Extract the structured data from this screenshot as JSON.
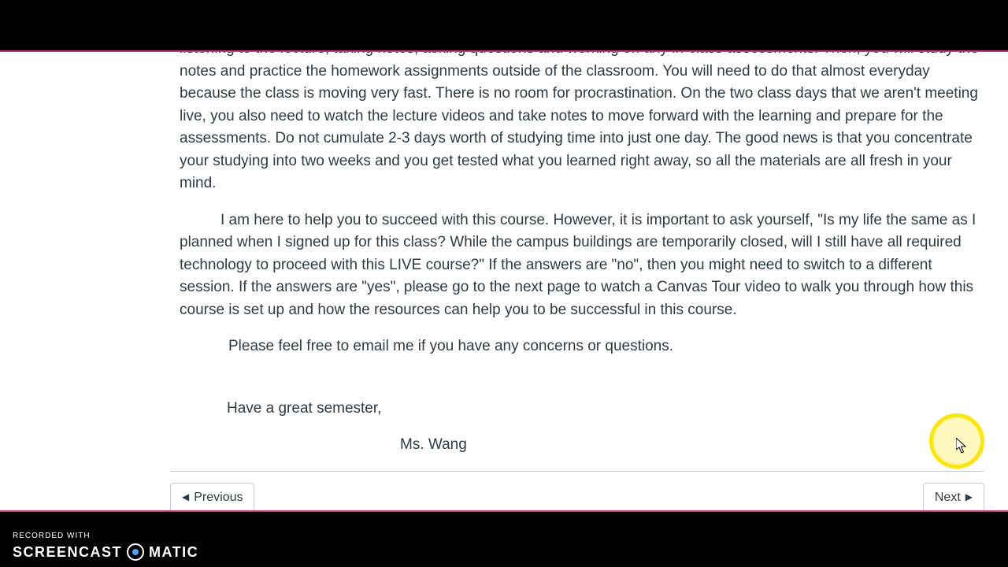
{
  "paragraphs": {
    "p1": "listening to the lecture, taking notes, asking questions and working on any in-class assessments. Then, you will study the notes and practice the homework assignments outside of the classroom. You will need to do that almost everyday because the class is moving very fast. There is no room for procrastination. On the two class days that we aren't meeting live, you also need to watch the lecture videos and take notes to move forward with the learning and  prepare for the assessments. Do not cumulate 2-3 days worth of studying time into just one day. The good news is that you concentrate your studying into two weeks and you get tested what you learned right away, so all the materials are all fresh in your mind.",
    "p2": "I am here to help you to succeed with this course. However, it is important to ask yourself, \"Is my life the same as I planned when I signed up for this class? While the campus buildings are temporarily closed, will I still have all required technology to proceed with this LIVE course?\" If the answers are \"no\", then you might need to switch to a different session. If the answers are \"yes\", please go to the next page to watch a Canvas Tour video to walk you through how this course is set up and how the resources can help you to be successful in this course.",
    "p3": "Please feel free to email me if you have any concerns or questions.",
    "closing": "Have a great semester,",
    "signature": "Ms. Wang"
  },
  "nav": {
    "previous": "Previous",
    "next": "Next"
  },
  "watermark": {
    "line1": "RECORDED WITH",
    "word1": "SCREENCAST",
    "word2": "MATIC"
  }
}
